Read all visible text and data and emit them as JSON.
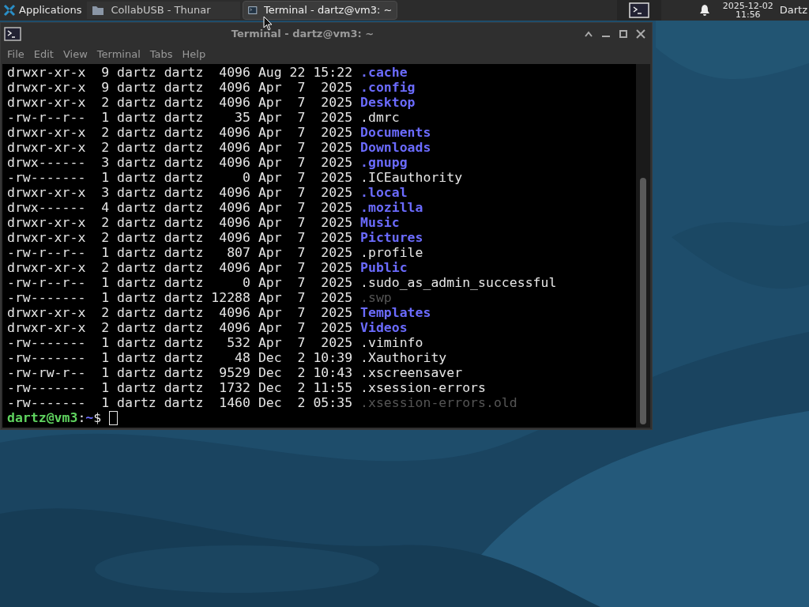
{
  "panel": {
    "applications": "Applications",
    "tasks": [
      {
        "label": "CollabUSB - Thunar",
        "kind": "folder",
        "selected": false
      },
      {
        "label": "Terminal - dartz@vm3: ~",
        "kind": "terminal",
        "selected": true
      }
    ],
    "date": "2025-12-02",
    "time": "11:56",
    "user": "Dartz"
  },
  "window": {
    "title": "Terminal - dartz@vm3: ~",
    "menu": [
      "File",
      "Edit",
      "View",
      "Terminal",
      "Tabs",
      "Help"
    ]
  },
  "lines": [
    {
      "text": "drwxr-xr-x  9 dartz dartz  4096 Aug 22 15:22",
      "name": ".cache",
      "kind": "dir"
    },
    {
      "text": "drwxr-xr-x  9 dartz dartz  4096 Apr  7  2025",
      "name": ".config",
      "kind": "dir"
    },
    {
      "text": "drwxr-xr-x  2 dartz dartz  4096 Apr  7  2025",
      "name": "Desktop",
      "kind": "dir"
    },
    {
      "text": "-rw-r--r--  1 dartz dartz    35 Apr  7  2025",
      "name": ".dmrc",
      "kind": "file"
    },
    {
      "text": "drwxr-xr-x  2 dartz dartz  4096 Apr  7  2025",
      "name": "Documents",
      "kind": "dir"
    },
    {
      "text": "drwxr-xr-x  2 dartz dartz  4096 Apr  7  2025",
      "name": "Downloads",
      "kind": "dir"
    },
    {
      "text": "drwx------  3 dartz dartz  4096 Apr  7  2025",
      "name": ".gnupg",
      "kind": "dir"
    },
    {
      "text": "-rw-------  1 dartz dartz     0 Apr  7  2025",
      "name": ".ICEauthority",
      "kind": "file"
    },
    {
      "text": "drwxr-xr-x  3 dartz dartz  4096 Apr  7  2025",
      "name": ".local",
      "kind": "dir"
    },
    {
      "text": "drwx------  4 dartz dartz  4096 Apr  7  2025",
      "name": ".mozilla",
      "kind": "dir"
    },
    {
      "text": "drwxr-xr-x  2 dartz dartz  4096 Apr  7  2025",
      "name": "Music",
      "kind": "dir"
    },
    {
      "text": "drwxr-xr-x  2 dartz dartz  4096 Apr  7  2025",
      "name": "Pictures",
      "kind": "dir"
    },
    {
      "text": "-rw-r--r--  1 dartz dartz   807 Apr  7  2025",
      "name": ".profile",
      "kind": "file"
    },
    {
      "text": "drwxr-xr-x  2 dartz dartz  4096 Apr  7  2025",
      "name": "Public",
      "kind": "dir"
    },
    {
      "text": "-rw-r--r--  1 dartz dartz     0 Apr  7  2025",
      "name": ".sudo_as_admin_successful",
      "kind": "file"
    },
    {
      "text": "-rw-------  1 dartz dartz 12288 Apr  7  2025",
      "name": ".swp",
      "kind": "dim"
    },
    {
      "text": "drwxr-xr-x  2 dartz dartz  4096 Apr  7  2025",
      "name": "Templates",
      "kind": "dir"
    },
    {
      "text": "drwxr-xr-x  2 dartz dartz  4096 Apr  7  2025",
      "name": "Videos",
      "kind": "dir"
    },
    {
      "text": "-rw-------  1 dartz dartz   532 Apr  7  2025",
      "name": ".viminfo",
      "kind": "file"
    },
    {
      "text": "-rw-------  1 dartz dartz    48 Dec  2 10:39",
      "name": ".Xauthority",
      "kind": "file"
    },
    {
      "text": "-rw-rw-r--  1 dartz dartz  9529 Dec  2 10:43",
      "name": ".xscreensaver",
      "kind": "file"
    },
    {
      "text": "-rw-------  1 dartz dartz  1732 Dec  2 11:55",
      "name": ".xsession-errors",
      "kind": "file"
    },
    {
      "text": "-rw-------  1 dartz dartz  1460 Dec  2 05:35",
      "name": ".xsession-errors.old",
      "kind": "dim"
    }
  ],
  "prompt": {
    "user_host": "dartz@vm3",
    "separator": ":",
    "path": "~",
    "symbol": "$"
  }
}
